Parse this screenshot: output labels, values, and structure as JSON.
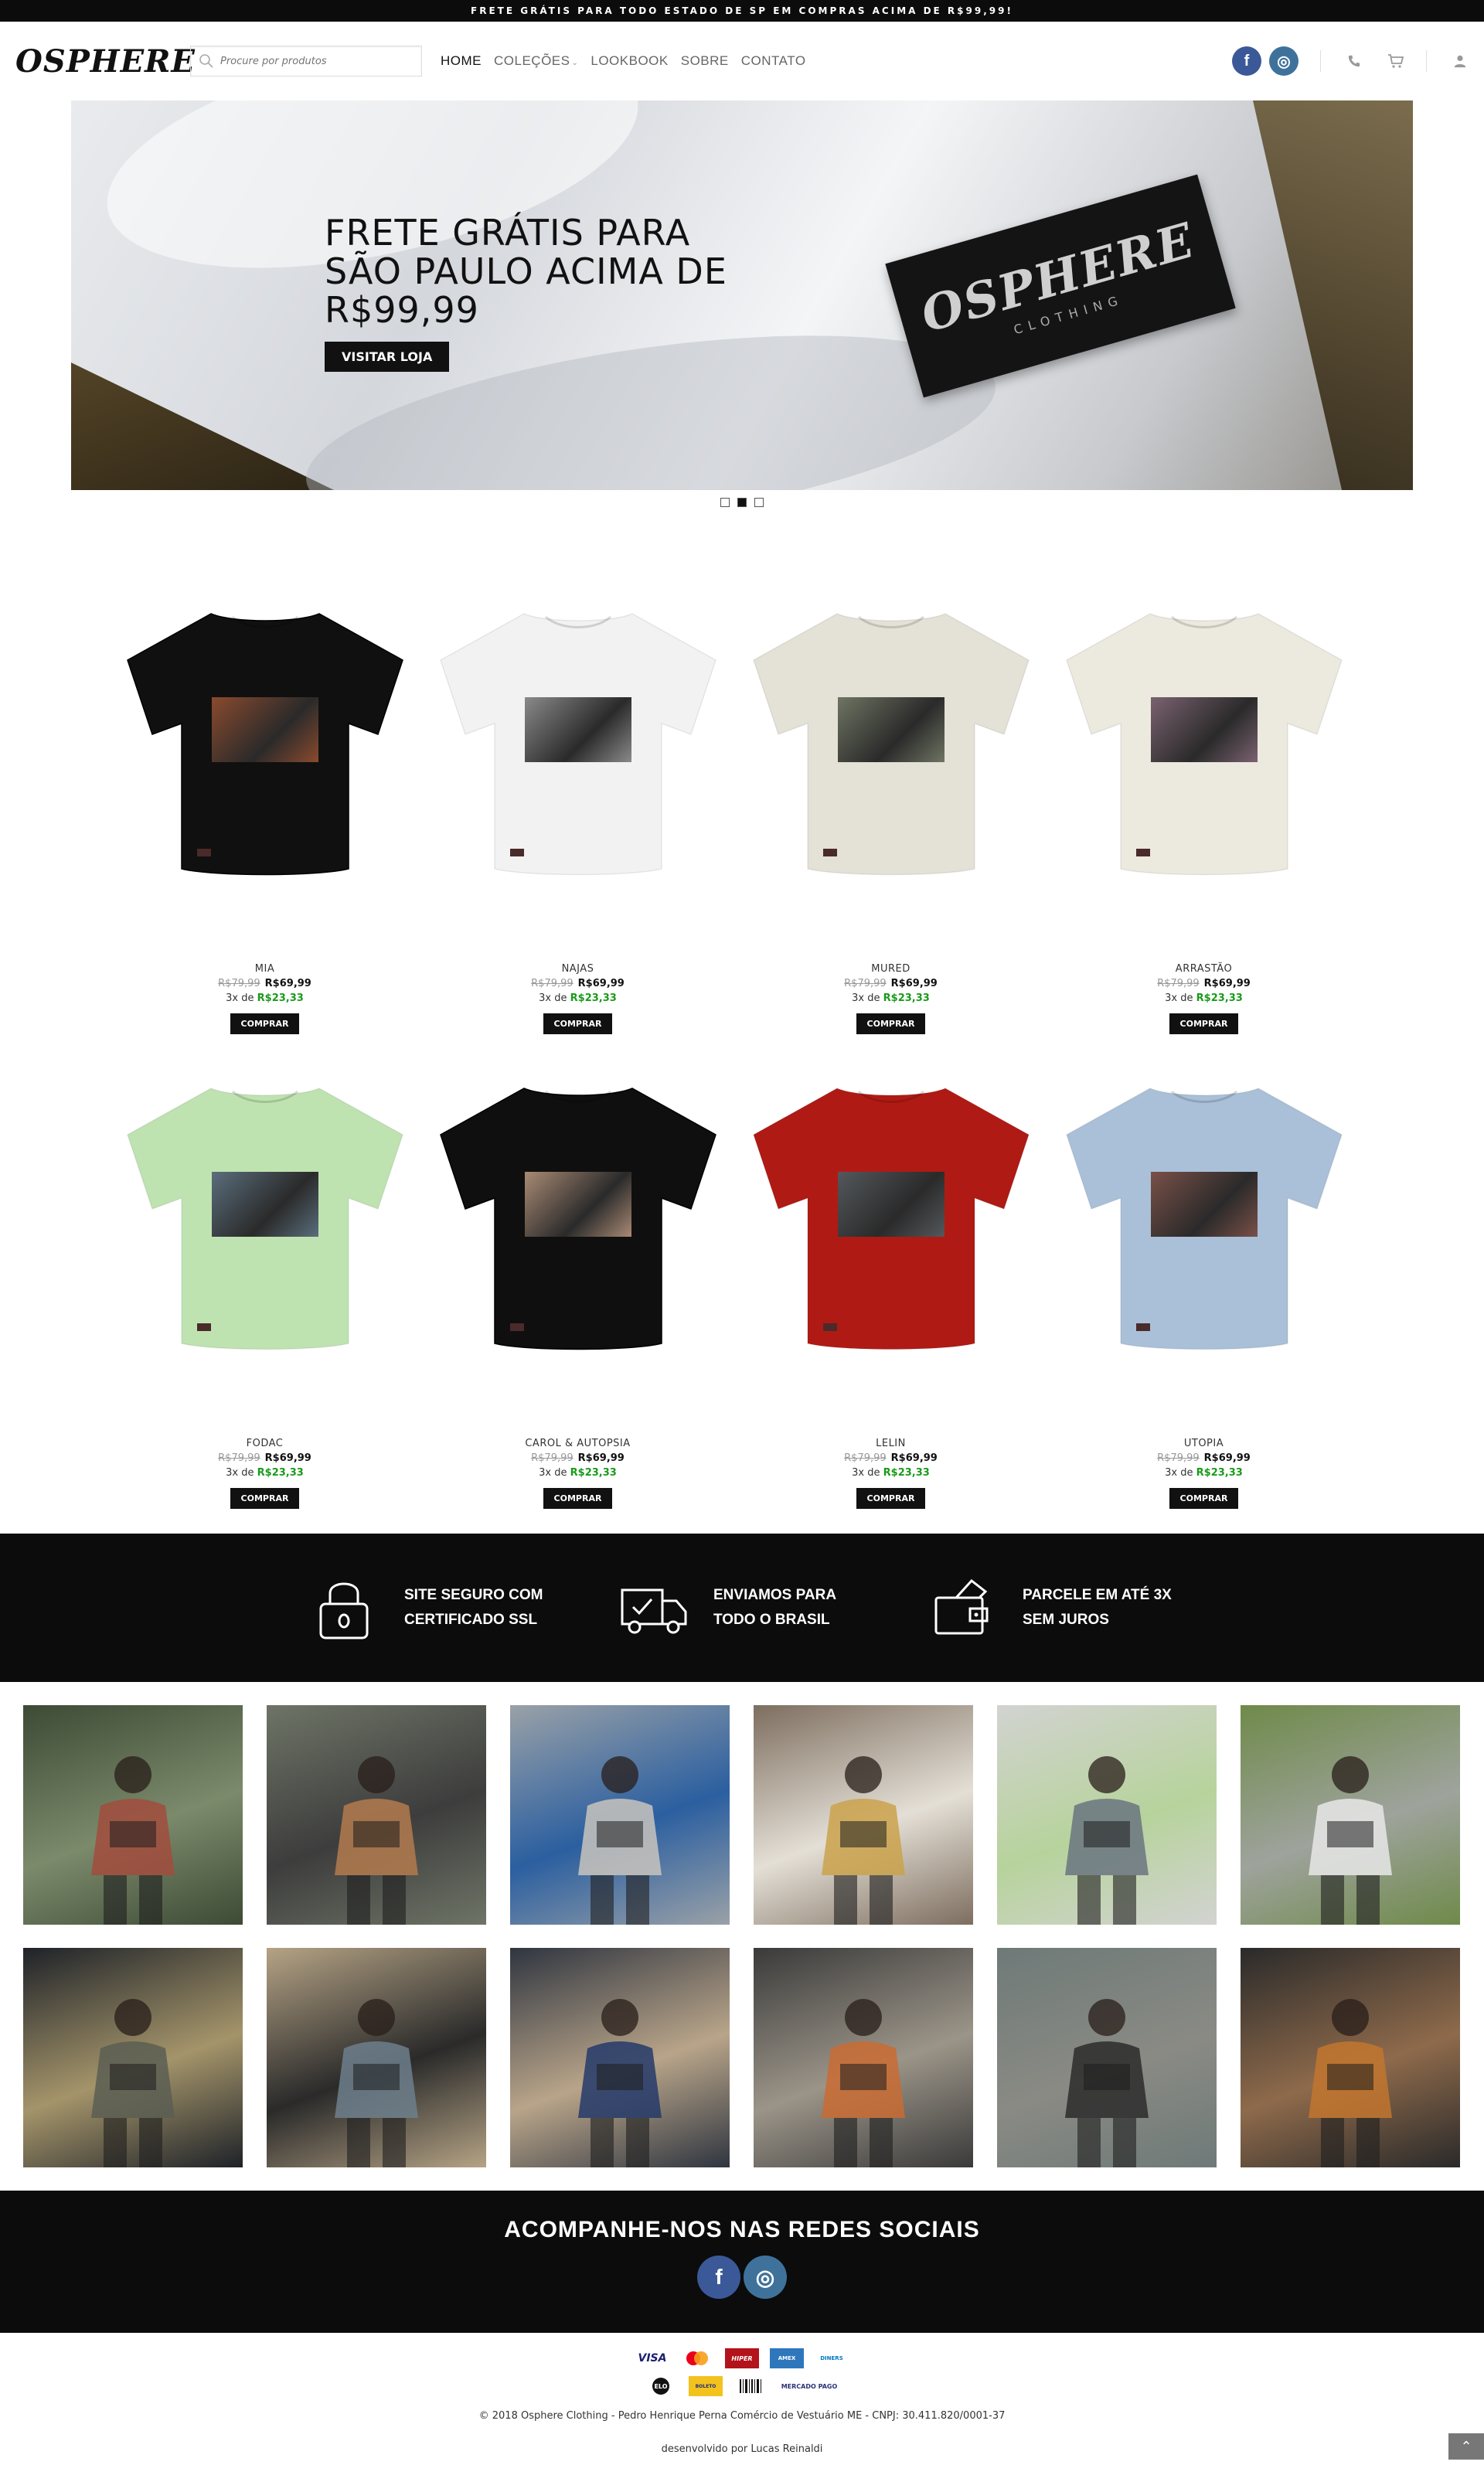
{
  "topbar": {
    "text": "FRETE GRÁTIS PARA TODO ESTADO DE SP EM COMPRAS ACIMA DE R$99,99!"
  },
  "header": {
    "logo": "OSPHERE",
    "search_placeholder": "Procure por produtos",
    "nav": [
      {
        "label": "HOME"
      },
      {
        "label": "COLEÇÕES"
      },
      {
        "label": "LOOKBOOK"
      },
      {
        "label": "SOBRE"
      },
      {
        "label": "CONTATO"
      }
    ],
    "facebook": "f",
    "instagram": "◎"
  },
  "hero": {
    "title": "FRETE GRÁTIS PARA SÃO PAULO ACIMA DE R$99,99",
    "button": "VISITAR LOJA",
    "tag_logo": "OSPHERE",
    "tag_sub": "CLOTHING",
    "slides": 3,
    "active_slide": 2
  },
  "products": [
    {
      "name": "MIA",
      "old": "R$79,99",
      "price": "R$69,99",
      "inst_prefix": "3x de",
      "inst": "R$23,33",
      "buy": "COMPRAR",
      "color": "#101010",
      "print": "#8a4a2e"
    },
    {
      "name": "NAJAS",
      "old": "R$79,99",
      "price": "R$69,99",
      "inst_prefix": "3x de",
      "inst": "R$23,33",
      "buy": "COMPRAR",
      "color": "#f2f2f2",
      "print": "#8a8a8a"
    },
    {
      "name": "MURED",
      "old": "R$79,99",
      "price": "R$69,99",
      "inst_prefix": "3x de",
      "inst": "R$23,33",
      "buy": "COMPRAR",
      "color": "#e4e1d6",
      "print": "#6f7462"
    },
    {
      "name": "ARRASTÃO",
      "old": "R$79,99",
      "price": "R$69,99",
      "inst_prefix": "3x de",
      "inst": "R$23,33",
      "buy": "COMPRAR",
      "color": "#ece9df",
      "print": "#7a6270"
    },
    {
      "name": "FODAC",
      "old": "R$79,99",
      "price": "R$69,99",
      "inst_prefix": "3x de",
      "inst": "R$23,33",
      "buy": "COMPRAR",
      "color": "#bfe3b0",
      "print": "#5a6e7c"
    },
    {
      "name": "CAROL & AUTOPSIA",
      "old": "R$79,99",
      "price": "R$69,99",
      "inst_prefix": "3x de",
      "inst": "R$23,33",
      "buy": "COMPRAR",
      "color": "#0f0f0f",
      "print": "#a98a74"
    },
    {
      "name": "LELIN",
      "old": "R$79,99",
      "price": "R$69,99",
      "inst_prefix": "3x de",
      "inst": "R$23,33",
      "buy": "COMPRAR",
      "color": "#b01a14",
      "print": "#54585c"
    },
    {
      "name": "UTOPIA",
      "old": "R$79,99",
      "price": "R$69,99",
      "inst_prefix": "3x de",
      "inst": "R$23,33",
      "buy": "COMPRAR",
      "color": "#a9c0d8",
      "print": "#7a5048"
    }
  ],
  "features": [
    {
      "label": "SITE SEGURO COM CERTIFICADO SSL",
      "icon": "lock-icon"
    },
    {
      "label": "ENVIAMOS PARA TODO O BRASIL",
      "icon": "truck-icon"
    },
    {
      "label": "PARCELE EM ATÉ 3X SEM JUROS",
      "icon": "wallet-icon"
    }
  ],
  "gallery": [
    {
      "c1": "#3d4a35",
      "c2": "#7b8a6b",
      "c3": "#a24c3d"
    },
    {
      "c1": "#6e7466",
      "c2": "#3d3d3d",
      "c3": "#b37b4d"
    },
    {
      "c1": "#9aa1a7",
      "c2": "#2b5fa0",
      "c3": "#c9c4bd"
    },
    {
      "c1": "#7d6e5f",
      "c2": "#e4dfd6",
      "c3": "#caa24b"
    },
    {
      "c1": "#d2d3d1",
      "c2": "#b7d39c",
      "c3": "#6a7480"
    },
    {
      "c1": "#6f8a4a",
      "c2": "#9ea39c",
      "c3": "#e8e8e8"
    },
    {
      "c1": "#1e2228",
      "c2": "#a4946a",
      "c3": "#5b5e52"
    },
    {
      "c1": "#b5a385",
      "c2": "#2a2a2a",
      "c3": "#6d7f8c"
    },
    {
      "c1": "#2f3540",
      "c2": "#b8a489",
      "c3": "#243a6a"
    },
    {
      "c1": "#3a3a3a",
      "c2": "#9b9488",
      "c3": "#c96b33"
    },
    {
      "c1": "#6e7a78",
      "c2": "#8a8a84",
      "c3": "#2b2b2b"
    },
    {
      "c1": "#2a2a2a",
      "c2": "#8e6a4b",
      "c3": "#c2762f"
    }
  ],
  "social": {
    "title": "ACOMPANHE-NOS NAS REDES SOCIAIS"
  },
  "footer": {
    "payments_row1": [
      "VISA",
      "MC",
      "HIPER",
      "AMEX",
      "DINERS"
    ],
    "payments_row2": [
      "ELO",
      "BOLETO",
      "BARCODE",
      "MERCADO PAGO"
    ],
    "copyright": "© 2018 Osphere Clothing - Pedro Henrique Perna Comércio de Vestuário ME - CNPJ: 30.411.820/0001-37",
    "developer": "desenvolvido por Lucas Reinaldi",
    "to_top": "⌃"
  }
}
